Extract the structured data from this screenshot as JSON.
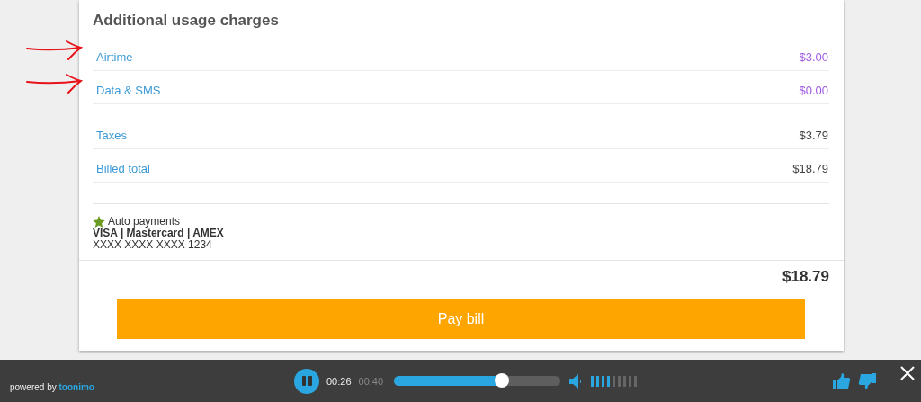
{
  "section": {
    "title": "Additional usage charges"
  },
  "charges": [
    {
      "label": "Airtime",
      "amount": "$3.00",
      "kind": "usage",
      "annotated": true
    },
    {
      "label": "Data & SMS",
      "amount": "$0.00",
      "kind": "usage",
      "annotated": true
    },
    {
      "label": "Taxes",
      "amount": "$3.79",
      "kind": "summary",
      "annotated": false
    },
    {
      "label": "Billed total",
      "amount": "$18.79",
      "kind": "summary",
      "annotated": false
    }
  ],
  "payment": {
    "title": "Auto payments",
    "cards": "VISA | Mastercard | AMEX",
    "number": "XXXX XXXX XXXX 1234"
  },
  "total": "$18.79",
  "pay_button": "Pay bill",
  "player": {
    "powered_by": "powered by",
    "brand": "toonimo",
    "playing": true,
    "elapsed": "00:26",
    "duration": "00:40",
    "level": 0.65,
    "volume": {
      "level": 0.44
    }
  }
}
